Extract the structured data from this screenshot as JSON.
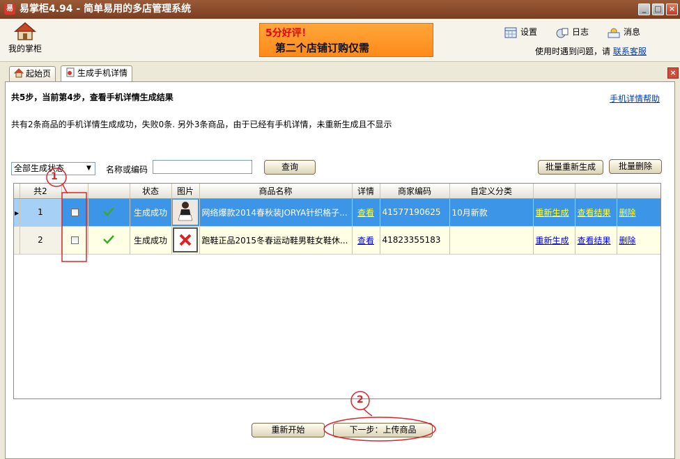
{
  "window": {
    "title": "易掌柜4.94 - 简单易用的多店管理系统",
    "app_icon_text": "易"
  },
  "header": {
    "home_label": "我的掌柜",
    "banner_line1": "5分好评！",
    "banner_line2": "第二个店铺订购仅需",
    "settings": "设置",
    "log": "日志",
    "messages": "消息",
    "help_prefix": "使用时遇到问题，请",
    "help_link": "联系客服"
  },
  "tabs": [
    {
      "label": "起始页"
    },
    {
      "label": "生成手机详情"
    }
  ],
  "page": {
    "step": "共5步，当前第4步，查看手机详情生成结果",
    "help_link": "手机详情帮助",
    "summary": "共有2条商品的手机详情生成成功，失败0条. 另外3条商品，由于已经有手机详情，未重新生成且不显示"
  },
  "filters": {
    "status_select": "全部生成状态",
    "name_label": "名称或编码",
    "name_value": "",
    "query_button": "查询",
    "batch_regen": "批量重新生成",
    "batch_delete": "批量删除"
  },
  "table": {
    "total_label": "共2",
    "headers": [
      "状态",
      "图片",
      "商品名称",
      "详情",
      "商家编码",
      "自定义分类"
    ],
    "rows": [
      {
        "num": "1",
        "status": "生成成功",
        "name": "网络爆款2014春秋装JORYA针织格子...",
        "detail": "查看",
        "code": "41577190625",
        "category": "10月新款",
        "regen": "重新生成",
        "view": "查看结果",
        "del": "删除"
      },
      {
        "num": "2",
        "status": "生成成功",
        "name": "跑鞋正品2015冬春运动鞋男鞋女鞋休...",
        "detail": "查看",
        "code": "41823355183",
        "category": "",
        "regen": "重新生成",
        "view": "查看结果",
        "del": "删除"
      }
    ]
  },
  "footer": {
    "restart": "重新开始",
    "next": "下一步：上传商品"
  },
  "annotations": {
    "marker1": "1",
    "marker2": "2"
  },
  "colors": {
    "title_bar": "#8a4a2a",
    "selected_row": "#3d95e8",
    "annotation": "#e0242a",
    "banner": "#ff9a2a"
  }
}
